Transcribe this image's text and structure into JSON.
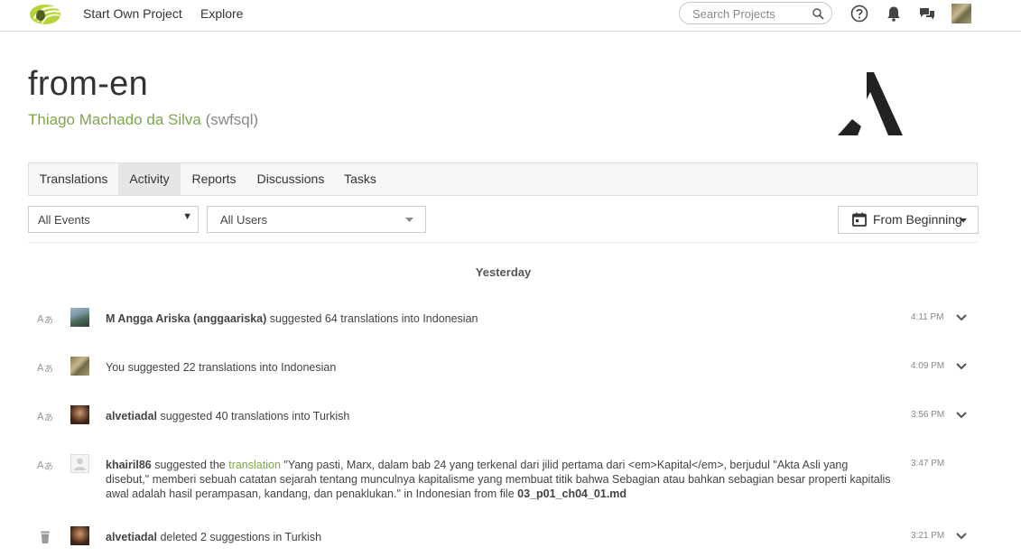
{
  "topbar": {
    "nav": [
      "Start Own Project",
      "Explore"
    ],
    "search_placeholder": "Search Projects"
  },
  "project": {
    "title": "from-en",
    "owner_name": "Thiago Machado da Silva",
    "owner_handle": "(swfsql)"
  },
  "tabs": [
    {
      "label": "Translations",
      "active": false
    },
    {
      "label": "Activity",
      "active": true
    },
    {
      "label": "Reports",
      "active": false
    },
    {
      "label": "Discussions",
      "active": false
    },
    {
      "label": "Tasks",
      "active": false
    }
  ],
  "filters": {
    "events": "All Events",
    "users": "All Users",
    "date_range": "From Beginning"
  },
  "day_heading": "Yesterday",
  "activities": [
    {
      "icon": "translate-icon",
      "user": "M Angga Ariska (anggaariska)",
      "action": " suggested 64 translations into Indonesian",
      "time": "4:11 PM"
    },
    {
      "icon": "translate-icon",
      "user": "",
      "action": "You suggested 22 translations into Indonesian",
      "time": "4:09 PM"
    },
    {
      "icon": "translate-icon",
      "user": "alvetiadal",
      "action": " suggested 40 translations into Turkish",
      "time": "3:56 PM"
    },
    {
      "icon": "translate-icon",
      "user": "khairil86",
      "action_pre": " suggested the ",
      "link": "translation",
      "quote": " \"Yang pasti, Marx, dalam bab 24 yang terkenal dari jilid pertama dari <em>Kapital</em>, berjudul \"Akta Asli yang disebut,\" memberi sebuah catatan sejarah tentang munculnya kapitalisme yang membuat titik bahwa Sebagian atau bahkan sebagian besar properti kapitalis awal adalah hasil perampasan, kandang, dan penaklukan.\" in Indonesian from file ",
      "file": "03_p01_ch04_01.md",
      "time": "3:47 PM"
    },
    {
      "icon": "trash-icon",
      "user": "alvetiadal",
      "action": " deleted 2 suggestions in Turkish",
      "time": "3:21 PM"
    }
  ],
  "colors": {
    "accent": "#7ea64a",
    "text": "#333333",
    "muted": "#888888"
  }
}
